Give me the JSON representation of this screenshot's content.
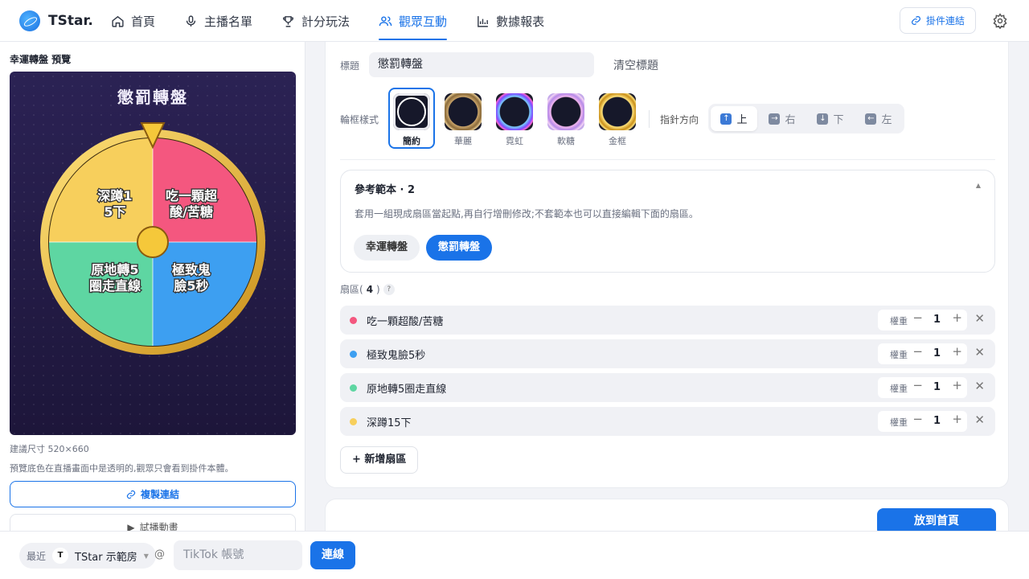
{
  "app": {
    "name": "TStar."
  },
  "nav": [
    {
      "label": "首頁",
      "icon": "home-icon"
    },
    {
      "label": "主播名單",
      "icon": "microphone-icon"
    },
    {
      "label": "計分玩法",
      "icon": "trophy-icon"
    },
    {
      "label": "觀眾互動",
      "icon": "users-icon",
      "active": true
    },
    {
      "label": "數據報表",
      "icon": "bar-chart-icon"
    }
  ],
  "header": {
    "widget_link": "掛件連結"
  },
  "preview": {
    "heading": "幸運轉盤 預覽",
    "wheel_title": "懲罰轉盤",
    "size_hint": "建議尺寸 520×660",
    "bg_hint": "預覽底色在直播畫面中是透明的,觀眾只會看到掛件本體。",
    "copy_link": "複製連結",
    "play_test": "試播動畫"
  },
  "form": {
    "title_label": "標題",
    "title_value": "懲罰轉盤",
    "clear_title": "清空標題",
    "frame_label": "輪框樣式",
    "frames": [
      "簡約",
      "華麗",
      "霓虹",
      "軟糖",
      "金框"
    ],
    "pointer_label": "指針方向",
    "pointer_dirs": [
      {
        "arrow": "↑",
        "label": "上",
        "selected": true
      },
      {
        "arrow": "→",
        "label": "右"
      },
      {
        "arrow": "↓",
        "label": "下"
      },
      {
        "arrow": "←",
        "label": "左"
      }
    ]
  },
  "templates": {
    "heading": "參考範本 · 2",
    "desc": "套用一組現成扇區當起點,再自行增刪修改;不套範本也可以直接編輯下面的扇區。",
    "items": [
      "幸運轉盤",
      "懲罰轉盤"
    ],
    "selected": "懲罰轉盤"
  },
  "sectors": {
    "label": "扇區(",
    "count": "4",
    "close": ")",
    "help": "?",
    "weight_label": "權重",
    "items": [
      {
        "name": "吃一顆超酸/苦糖",
        "color": "#f4577f",
        "weight": "1",
        "wheel_text": "吃一顆超\n酸/苦糖"
      },
      {
        "name": "極致鬼臉5秒",
        "color": "#3d9ff1",
        "weight": "1",
        "wheel_text": "極致鬼\n臉5秒"
      },
      {
        "name": "原地轉5圈走直線",
        "color": "#5ed6a2",
        "weight": "1",
        "wheel_text": "原地轉5\n圈走直線"
      },
      {
        "name": "深蹲15下",
        "color": "#f7cf5c",
        "weight": "1",
        "wheel_text": "深蹲1\n5下"
      }
    ],
    "add": "新增扇區"
  },
  "actions": {
    "home": "放到首頁"
  },
  "bottom": {
    "recent": "最近",
    "room_initial": "T",
    "room": "TStar 示範房",
    "at": "@",
    "tiktok_placeholder": "TikTok 帳號",
    "connect": "連線"
  }
}
